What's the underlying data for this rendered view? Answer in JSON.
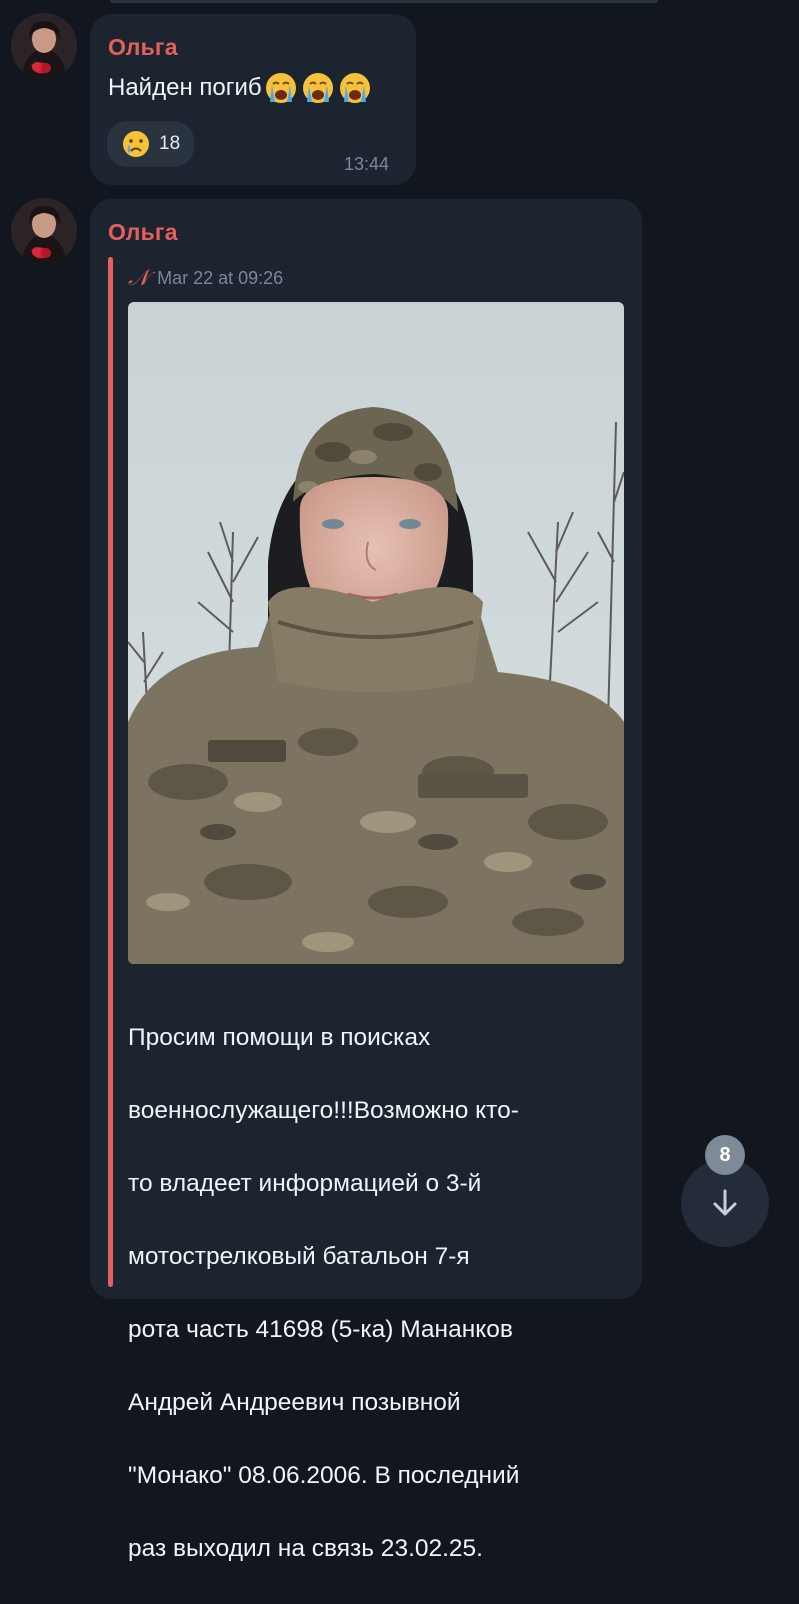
{
  "messages": [
    {
      "sender": "Ольга",
      "text": "Найден погиб",
      "emojis": [
        "loudly-crying-face",
        "loudly-crying-face",
        "loudly-crying-face"
      ],
      "reaction": {
        "emoji": "crying-face",
        "count": "18"
      },
      "time": "13:44"
    },
    {
      "sender": "Ольга",
      "forward": {
        "date": "Mar 22 at 09:26"
      },
      "photo_alt": "selfie of soldier in camouflage",
      "caption_lines": [
        "Просим помощи в поисках",
        "военнослужащего!!!Возможно кто-",
        "то владеет информацией о 3-й",
        "мотострелковый батальон 7-я",
        "рота часть 41698 (5-ка) Мананков",
        "Андрей Андреевич позывной",
        "\"Монако\" 08.06.2006. В последний",
        "раз выходил на связь 23.02.25."
      ]
    }
  ],
  "scroll_button": {
    "unread_count": "8"
  },
  "colors": {
    "background": "#12171f",
    "bubble": "#1c2430",
    "accent": "#e5605c",
    "meta": "#7c8796"
  }
}
